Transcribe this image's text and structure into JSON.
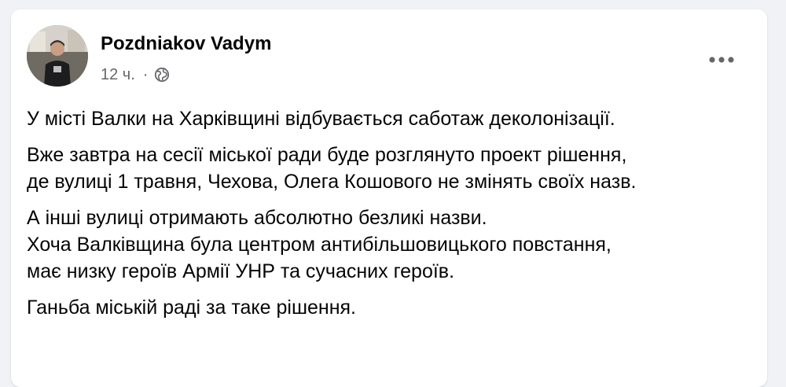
{
  "post": {
    "author": "Pozdniakov Vadym",
    "time": "12 ч.",
    "separator": "·",
    "privacy_icon": "globe-icon",
    "more_icon": "more-options-icon",
    "paragraphs": [
      [
        "У місті Валки на Харківщині відбувається саботаж деколонізації."
      ],
      [
        "Вже завтра на сесії міської ради буде розглянуто проект рішення,",
        "де вулиці 1 травня, Чехова, Олега Кошового не змінять своїх назв."
      ],
      [
        "А інші вулиці отримають абсолютно безликі назви.",
        "Хоча Валківщина була центром антибільшовицького повстання,",
        "має низку героїв Армії УНР та сучасних героїв."
      ],
      [
        "Ганьба міській раді за таке рішення."
      ]
    ]
  }
}
